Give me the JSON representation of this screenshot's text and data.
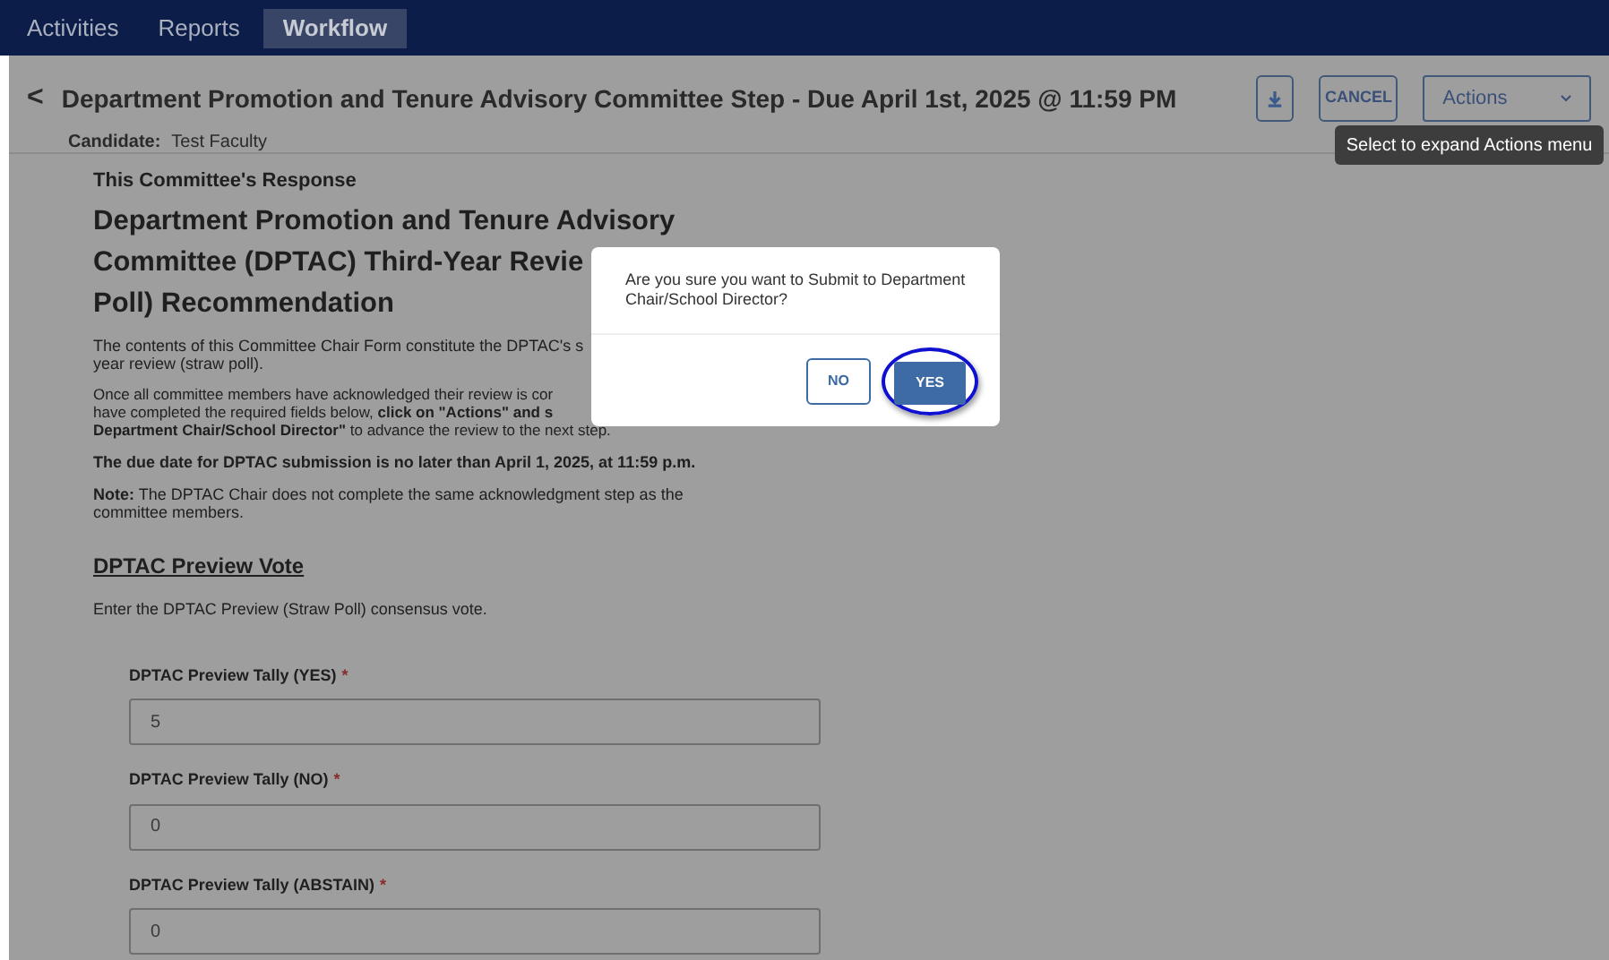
{
  "nav": {
    "tabs": [
      {
        "label": "Activities",
        "selected": false
      },
      {
        "label": "Reports",
        "selected": false
      },
      {
        "label": "Workflow",
        "selected": true
      }
    ]
  },
  "header": {
    "back": "<",
    "title": "Department Promotion and Tenure Advisory Committee Step - Due April 1st, 2025 @ 11:59 PM",
    "candidate_label": "Candidate:",
    "candidate": "Test Faculty",
    "cancel": "CANCEL",
    "actions": "Actions",
    "tooltip": "Select to expand Actions menu"
  },
  "form": {
    "section_label": "This Committee's Response",
    "heading_lines": [
      "Department Promotion and Tenure Advisory",
      "Committee (DPTAC) Third-Year Revie",
      "Poll) Recommendation"
    ],
    "para1_lines": [
      "The contents of this Committee Chair Form constitute the DPTAC's s",
      "year review (straw poll)."
    ],
    "para2_lines": [
      "Once all committee members have acknowledged their review is cor",
      "have completed the required fields below, **click on \"Actions\" and s**",
      "**Department Chair/School Director\"** to advance the review to the next step."
    ],
    "due": "The due date for DPTAC submission is no later than April 1, 2025, at 11:59 p.m.",
    "note": "**Note:** The DPTAC Chair does not complete the same acknowledgment step as the committee members.",
    "vote_title": "DPTAC Preview Vote",
    "vote_intro": "Enter the DPTAC Preview (Straw Poll) consensus vote.",
    "fields": [
      {
        "label": "DPTAC Preview Tally (YES)",
        "required": true,
        "required_mark": "*",
        "value": "5"
      },
      {
        "label": "DPTAC Preview Tally (NO)",
        "required": true,
        "required_mark": "*",
        "value": "0"
      },
      {
        "label": "DPTAC Preview Tally (ABSTAIN)",
        "required": true,
        "required_mark": "*",
        "value": "0"
      }
    ]
  },
  "dialog": {
    "message": "Are you sure you want to Submit to Department Chair/School Director?",
    "no": "NO",
    "yes": "YES",
    "yes_circled": true
  }
}
